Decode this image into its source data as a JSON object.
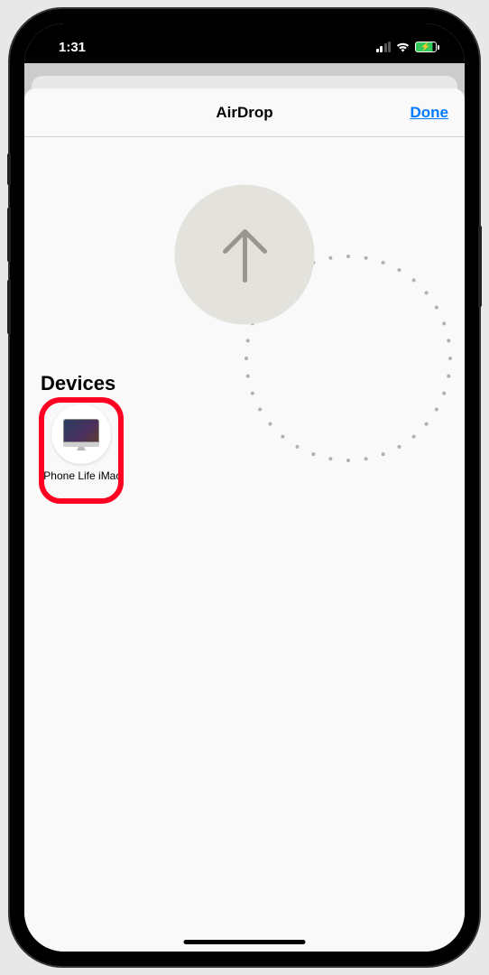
{
  "status_bar": {
    "time": "1:31"
  },
  "sheet": {
    "title": "AirDrop",
    "done_label": "Done"
  },
  "devices": {
    "section_title": "Devices",
    "items": [
      {
        "name": "iPhone Life iMac",
        "icon": "imac-icon"
      }
    ]
  }
}
